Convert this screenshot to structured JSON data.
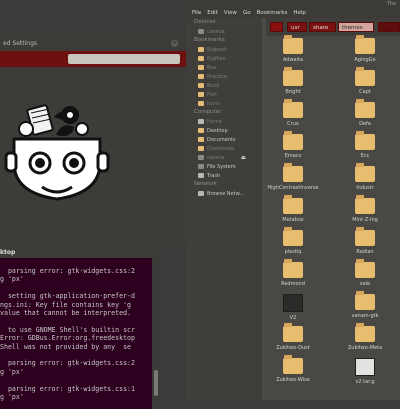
{
  "file_manager": {
    "title": "The",
    "menu": [
      "File",
      "Edit",
      "View",
      "Go",
      "Bookmarks",
      "Help"
    ],
    "sidebar": [
      {
        "type": "head",
        "label": "Devices"
      },
      {
        "type": "item",
        "icon": "drive",
        "label": "casmia"
      },
      {
        "type": "head",
        "label": "Bookmarks"
      },
      {
        "type": "item",
        "icon": "folder",
        "label": "Bigbook"
      },
      {
        "type": "item",
        "icon": "folder",
        "label": "Bigfiles"
      },
      {
        "type": "item",
        "icon": "folder",
        "label": "Box"
      },
      {
        "type": "item",
        "icon": "folder",
        "label": "Practice"
      },
      {
        "type": "item",
        "icon": "folder",
        "label": "Book"
      },
      {
        "type": "item",
        "icon": "folder",
        "label": "Port"
      },
      {
        "type": "item",
        "icon": "folder",
        "label": "icons"
      },
      {
        "type": "head",
        "label": "Computer"
      },
      {
        "type": "item",
        "icon": "home",
        "label": "Home"
      },
      {
        "type": "item",
        "icon": "folder",
        "label": "Desktop",
        "lit": true
      },
      {
        "type": "item",
        "icon": "folder",
        "label": "Documents",
        "lit": true
      },
      {
        "type": "item",
        "icon": "folder",
        "label": "Downloads"
      },
      {
        "type": "item",
        "icon": "drive",
        "label": "casmia",
        "eject": "⏏"
      },
      {
        "type": "item",
        "icon": "drive",
        "label": "File System",
        "lit": true
      },
      {
        "type": "item",
        "icon": "trash",
        "label": "Trash",
        "lit": true
      },
      {
        "type": "head",
        "label": "Network"
      },
      {
        "type": "item",
        "icon": "net",
        "label": "Browse Netw...",
        "lit": true
      }
    ],
    "path": [
      "usr",
      "share",
      "themes"
    ],
    "items": [
      {
        "label": "Adwaita",
        "kind": "folder"
      },
      {
        "label": "AgingGo",
        "kind": "folder"
      },
      {
        "label": "Bright",
        "kind": "folder"
      },
      {
        "label": "Capt",
        "kind": "folder"
      },
      {
        "label": "Crux",
        "kind": "folder"
      },
      {
        "label": "Defa",
        "kind": "folder"
      },
      {
        "label": "Emacs",
        "kind": "folder"
      },
      {
        "label": "Ecc",
        "kind": "folder"
      },
      {
        "label": "HighContrastInverse",
        "kind": "folder"
      },
      {
        "label": "Industr",
        "kind": "folder"
      },
      {
        "label": "Metabox",
        "kind": "folder"
      },
      {
        "label": "Mint-Z-Ing",
        "kind": "folder"
      },
      {
        "label": "plastiq",
        "kind": "folder"
      },
      {
        "label": "Radian",
        "kind": "folder"
      },
      {
        "label": "Redmond",
        "kind": "folder"
      },
      {
        "label": "sale",
        "kind": "folder"
      },
      {
        "label": "V2",
        "kind": "dark"
      },
      {
        "label": "vanam-gtk",
        "kind": "folder"
      },
      {
        "label": "Zukitwo-Dust",
        "kind": "folder"
      },
      {
        "label": "Zukitwo-Meta",
        "kind": "folder"
      },
      {
        "label": "Zukitwo-Wise",
        "kind": "folder"
      },
      {
        "label": "v2.tar.g",
        "kind": "light"
      }
    ]
  },
  "settings": {
    "title": "ed Settings",
    "close": "×",
    "search_placeholder": ""
  },
  "terminal": {
    "title": "ktop",
    "lines": [
      "  parsing error: gtk-widgets.css:2",
      "g 'px'",
      "",
      "  setting gtk-application-prefer-d",
      "ngs.ini: Key file contains key 'g",
      "value that cannot be interpreted.",
      "",
      "  to use GNOME Shell's builtin scr",
      "Error: GDBus.Error:org.freedesktop",
      "Shell was not provided by any  se",
      "",
      "  parsing error: gtk-widgets.css:2",
      "g 'px'",
      "",
      "  parsing error: gtk-widgets.css:1",
      "g 'px'"
    ]
  },
  "colors": {
    "accent": "#7a1010",
    "folder": "#e9bd70",
    "terminal_bg": "#2c001e"
  }
}
